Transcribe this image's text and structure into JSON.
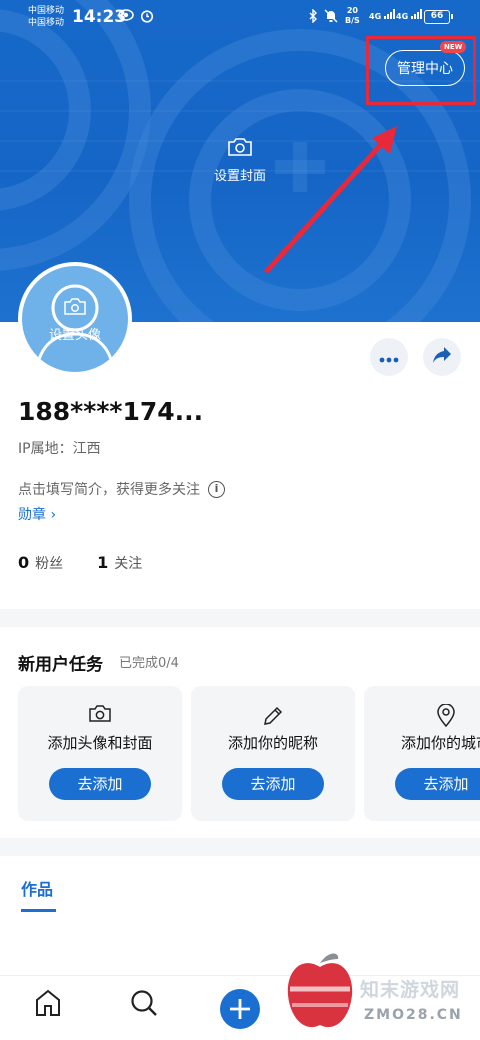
{
  "colors": {
    "cover_blue": "#1565c6",
    "accent": "#1a6fd1",
    "highlight_red": "#e8293a"
  },
  "status_bar": {
    "carrier1": "中国移动",
    "carrier2": "中国移动",
    "time": "14:23",
    "net_speed_value": "20",
    "net_speed_unit": "B/S",
    "signal1_label": "4G",
    "signal2_label": "4G",
    "battery": "66",
    "icons": [
      "eye-icon",
      "alarm-icon",
      "bluetooth-icon",
      "silent-bell-icon",
      "vibrate-icon"
    ]
  },
  "cover": {
    "manage_center_label": "管理中心",
    "new_badge": "NEW",
    "set_cover_label": "设置封面"
  },
  "avatar": {
    "label": "设置头像"
  },
  "profile": {
    "username": "188****174...",
    "ip_location": "IP属地：江西",
    "bio_prompt": "点击填写简介，获得更多关注",
    "badge_link": "勋章 ›",
    "followers_count": "0",
    "followers_label": "粉丝",
    "following_count": "1",
    "following_label": "关注"
  },
  "tasks": {
    "title": "新用户任务",
    "progress": "已完成0/4",
    "items": [
      {
        "label": "添加头像和封面",
        "button": "去添加",
        "icon": "camera-icon"
      },
      {
        "label": "添加你的昵称",
        "button": "去添加",
        "icon": "pencil-icon"
      },
      {
        "label": "添加你的城市",
        "button": "去添加",
        "icon": "location-pin-icon"
      }
    ]
  },
  "tabs": {
    "works": "作品"
  },
  "bottom_nav": {
    "items": [
      "home-icon",
      "search-icon",
      "add-icon"
    ]
  },
  "watermark": {
    "text": "知末游戏网",
    "sub": "ZMO28.CN"
  }
}
